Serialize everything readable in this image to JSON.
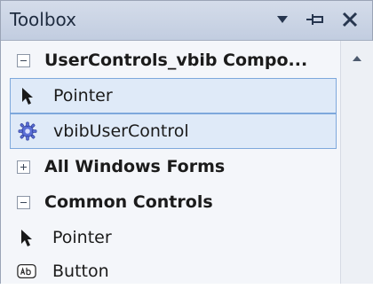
{
  "window": {
    "title": "Toolbox",
    "controls": [
      "chevron-down-icon",
      "pin-icon",
      "close-icon"
    ]
  },
  "items": [
    {
      "type": "group",
      "expanded": true,
      "label": "UserControls_vbib Compo..."
    },
    {
      "type": "tool",
      "icon": "pointer-icon",
      "label": "Pointer",
      "selected": true
    },
    {
      "type": "tool",
      "icon": "gear-icon",
      "label": "vbibUserControl",
      "selected": true
    },
    {
      "type": "group",
      "expanded": false,
      "label": "All Windows Forms"
    },
    {
      "type": "group",
      "expanded": true,
      "label": "Common Controls"
    },
    {
      "type": "tool",
      "icon": "pointer-icon",
      "label": "Pointer",
      "selected": false
    },
    {
      "type": "tool",
      "icon": "button-ab-icon",
      "label": "Button",
      "selected": false
    }
  ],
  "colors": {
    "title_bar": "#c8d2e3",
    "selection": "#dfeaf8",
    "selection_border": "#7ea8dc"
  }
}
